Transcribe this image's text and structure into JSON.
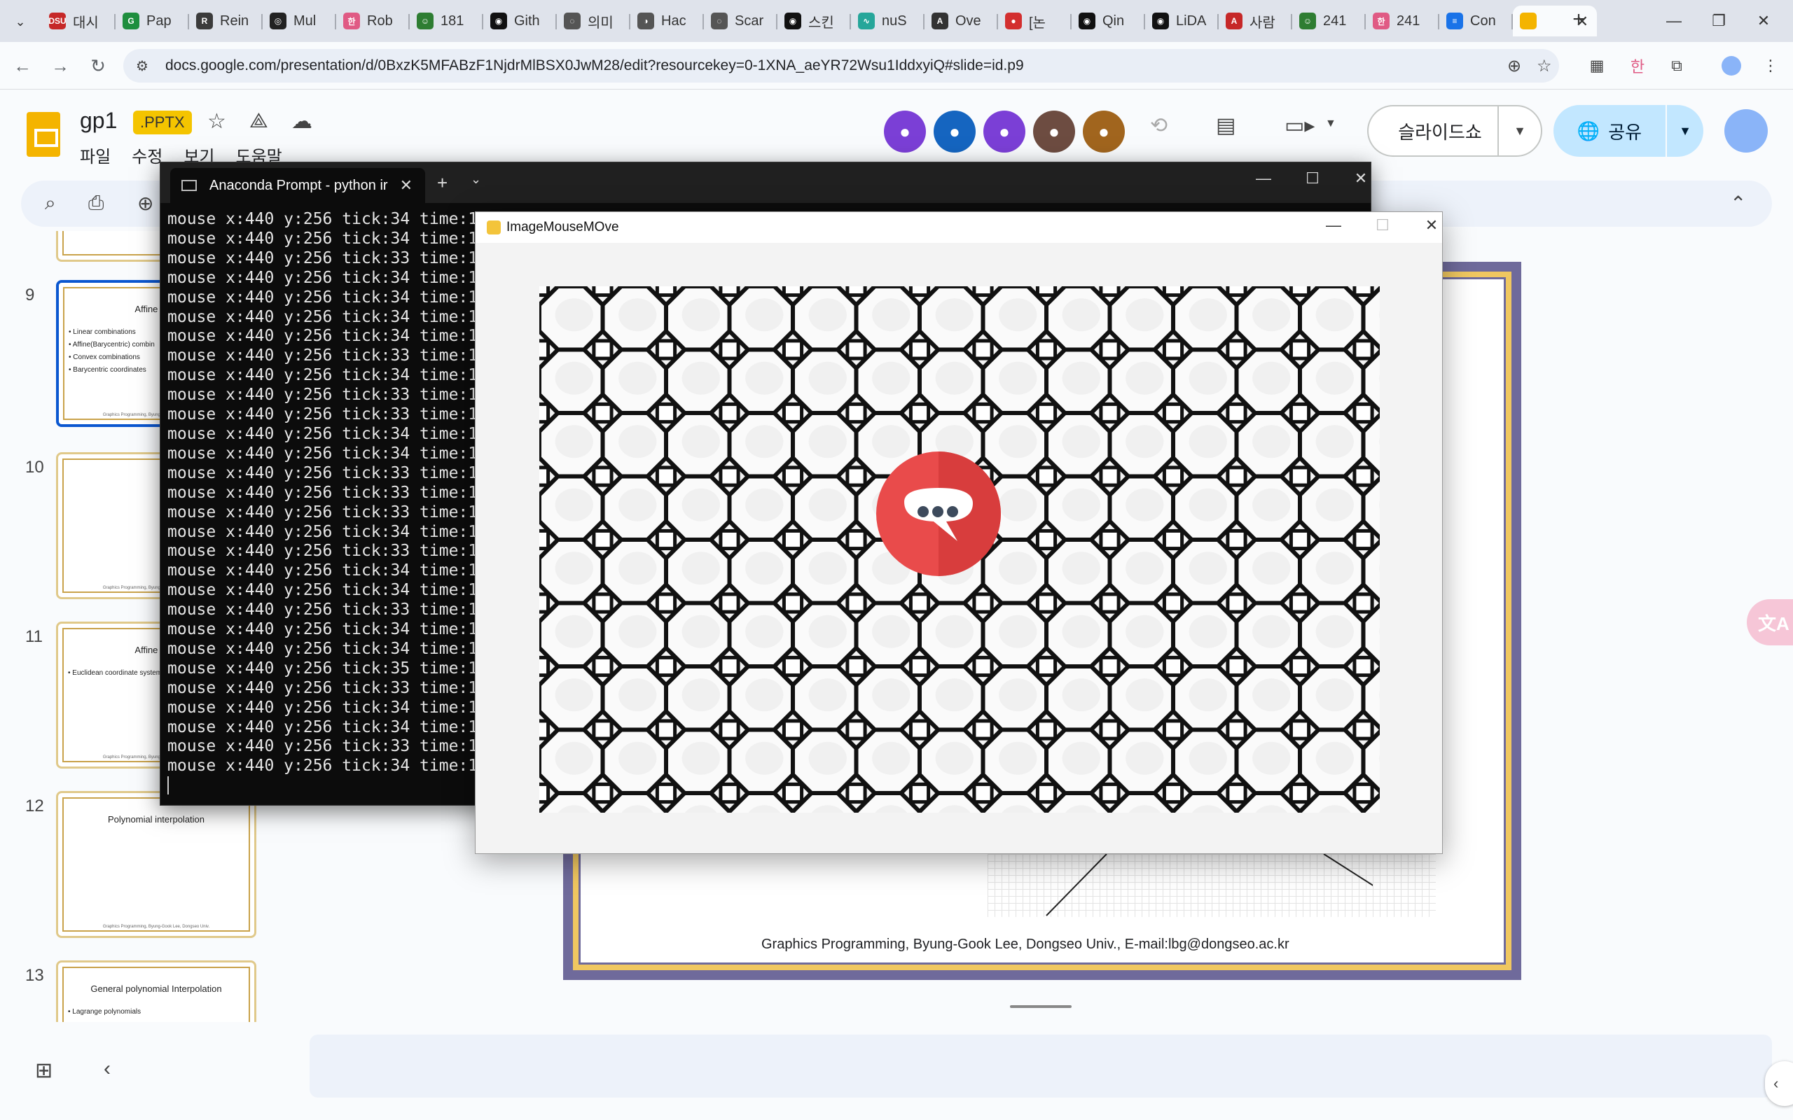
{
  "browser": {
    "tabs": [
      {
        "label": "대시",
        "color": "#c62828",
        "glyph": "DSU"
      },
      {
        "label": "Pap",
        "color": "#1e8e3e",
        "glyph": "G"
      },
      {
        "label": "Rein",
        "color": "#3b3b3b",
        "glyph": "R"
      },
      {
        "label": "Mul",
        "color": "#222222",
        "glyph": "◎"
      },
      {
        "label": "Rob",
        "color": "#e05a84",
        "glyph": "한"
      },
      {
        "label": "181",
        "color": "#2e7d32",
        "glyph": "☺"
      },
      {
        "label": "Gith",
        "color": "#111111",
        "glyph": "◉"
      },
      {
        "label": "의미",
        "color": "#555555",
        "glyph": "◌"
      },
      {
        "label": "Hac",
        "color": "#555555",
        "glyph": "◑"
      },
      {
        "label": "Scar",
        "color": "#555555",
        "glyph": "◌"
      },
      {
        "label": "스킨",
        "color": "#111111",
        "glyph": "◉"
      },
      {
        "label": "nuS",
        "color": "#26a69a",
        "glyph": "∿"
      },
      {
        "label": "Ove",
        "color": "#333333",
        "glyph": "A"
      },
      {
        "label": "[논",
        "color": "#d32f2f",
        "glyph": "●"
      },
      {
        "label": "Qin",
        "color": "#111111",
        "glyph": "◉"
      },
      {
        "label": "LiDA",
        "color": "#111111",
        "glyph": "◉"
      },
      {
        "label": "사람",
        "color": "#c62828",
        "glyph": "A"
      },
      {
        "label": "241",
        "color": "#2e7d32",
        "glyph": "☺"
      },
      {
        "label": "241",
        "color": "#e05a84",
        "glyph": "한"
      },
      {
        "label": "Con",
        "color": "#1a73e8",
        "glyph": "≡"
      }
    ],
    "active_tab_color": "#f4b400",
    "url": "docs.google.com/presentation/d/0BxzK5MFABzF1NjdrMlBSX0JwM28/edit?resourcekey=0-1XNA_aeYR72Wsu1IddxyiQ#slide=id.p9"
  },
  "slides_app": {
    "doc_title": "gp1",
    "format_badge": ".PPTX",
    "menu": [
      "파일",
      "수정",
      "보기",
      "도움말"
    ],
    "slideshow_label": "슬라이드쇼",
    "share_label": "공유",
    "accent_color": "#c2e7ff",
    "collaborators": [
      {
        "color": "#7b3fd6",
        "icon": "fox-avatar"
      },
      {
        "color": "#1565c0",
        "icon": "ghost-avatar"
      },
      {
        "color": "#7b3fd6",
        "icon": "bat-avatar"
      },
      {
        "color": "#6d4c41",
        "icon": "nyan-avatar"
      },
      {
        "color": "#a1651e",
        "icon": "horse-avatar"
      }
    ]
  },
  "filmstrip": [
    {
      "num": "9",
      "title": "Affine com",
      "bullets": [
        "Linear combinations",
        "Affine(Barycentric) combin",
        "Convex combinations",
        "Barycentric coordinates"
      ],
      "selected": true
    },
    {
      "num": "10",
      "title": "",
      "bullets": [],
      "selected": false
    },
    {
      "num": "11",
      "title": "Affine com",
      "bullets": [
        "Euclidean coordinate system"
      ],
      "selected": false
    },
    {
      "num": "12",
      "title": "Polynomial interpolation",
      "bullets": [],
      "selected": false
    },
    {
      "num": "13",
      "title": "General polynomial Interpolation",
      "bullets": [
        "Lagrange polynomials"
      ],
      "selected": false
    }
  ],
  "thumb_footer": "Graphics Programming, Byung-Gook Lee, Dongseo Univ.",
  "slide": {
    "footer": "Graphics Programming, Byung-Gook Lee, Dongseo Univ., E-mail:lbg@dongseo.ac.kr"
  },
  "terminal": {
    "tab_title": "Anaconda Prompt - python  ir",
    "lines": [
      "mouse x:440 y:256 tick:34 time:1",
      "mouse x:440 y:256 tick:34 time:1",
      "mouse x:440 y:256 tick:33 time:1",
      "mouse x:440 y:256 tick:34 time:1",
      "mouse x:440 y:256 tick:34 time:1",
      "mouse x:440 y:256 tick:34 time:1",
      "mouse x:440 y:256 tick:34 time:1",
      "mouse x:440 y:256 tick:33 time:1",
      "mouse x:440 y:256 tick:34 time:1",
      "mouse x:440 y:256 tick:33 time:1",
      "mouse x:440 y:256 tick:33 time:1",
      "mouse x:440 y:256 tick:34 time:1",
      "mouse x:440 y:256 tick:34 time:1",
      "mouse x:440 y:256 tick:33 time:1",
      "mouse x:440 y:256 tick:33 time:1",
      "mouse x:440 y:256 tick:33 time:1",
      "mouse x:440 y:256 tick:34 time:1",
      "mouse x:440 y:256 tick:33 time:1",
      "mouse x:440 y:256 tick:34 time:1",
      "mouse x:440 y:256 tick:34 time:1",
      "mouse x:440 y:256 tick:33 time:1",
      "mouse x:440 y:256 tick:34 time:1",
      "mouse x:440 y:256 tick:34 time:1",
      "mouse x:440 y:256 tick:35 time:1",
      "mouse x:440 y:256 tick:33 time:1",
      "mouse x:440 y:256 tick:34 time:1",
      "mouse x:440 y:256 tick:34 time:1",
      "mouse x:440 y:256 tick:33 time:1",
      "mouse x:440 y:256 tick:34 time:1"
    ]
  },
  "pygame_window": {
    "title": "ImageMouseMOve",
    "loading_color": "#e94b4b"
  }
}
